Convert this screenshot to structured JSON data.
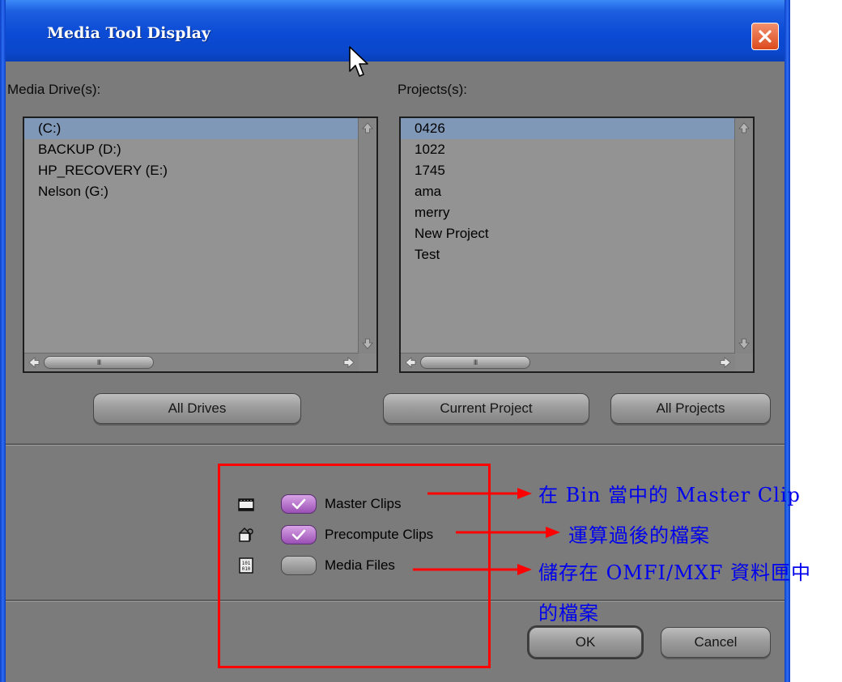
{
  "window": {
    "title": "Media Tool Display",
    "close_icon": "close-icon",
    "accent_color": "#0a47cc"
  },
  "drives": {
    "label": "Media Drive(s):",
    "items": [
      "(C:)",
      "BACKUP (D:)",
      "HP_RECOVERY (E:)",
      "Nelson (G:)"
    ],
    "selected": "(C:)"
  },
  "projects": {
    "label": "Projects(s):",
    "items": [
      "0426",
      "1022",
      "1745",
      "ama",
      "merry",
      "New Project",
      "Test"
    ],
    "selected": "0426"
  },
  "scroll_thumb_text": "III",
  "buttons": {
    "all_drives": "All Drives",
    "current_project": "Current Project",
    "all_projects": "All Projects",
    "ok": "OK",
    "cancel": "Cancel"
  },
  "checkboxes": [
    {
      "label": "Master Clips",
      "checked": true,
      "icon": "master-clip-icon"
    },
    {
      "label": "Precompute Clips",
      "checked": true,
      "icon": "precompute-clip-icon"
    },
    {
      "label": "Media Files",
      "checked": false,
      "icon": "media-file-icon"
    }
  ],
  "annotations": {
    "note1": "在 Bin 當中的 Master Clip",
    "note2": "運算過後的檔案",
    "note3_line1": "儲存在 OMFI/MXF 資料匣中",
    "note3_line2": "的檔案",
    "box_color": "#ff0000",
    "text_color": "#0000ee"
  }
}
